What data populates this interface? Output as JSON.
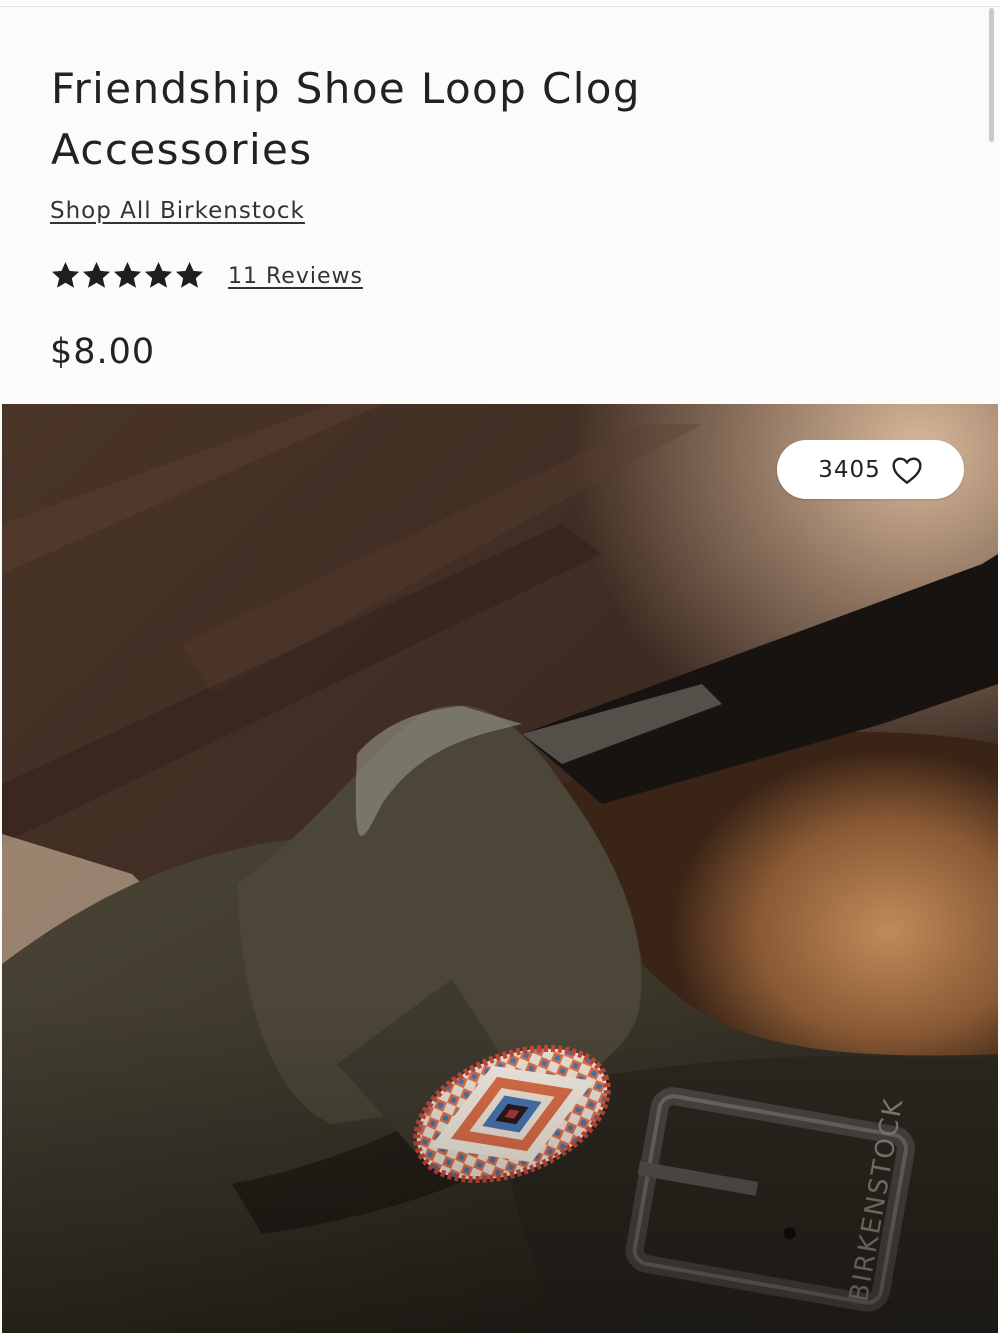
{
  "product": {
    "title": "Friendship Shoe Loop Clog Accessories",
    "brand_link": "Shop All Birkenstock",
    "rating": 5,
    "rating_max": 5,
    "reviews_link": "11 Reviews",
    "price": "$8.00"
  },
  "hero_image": {
    "subject": "suede clog strap with embroidered friendship loop",
    "stamp": "BIRKENSTOCK"
  },
  "like_button": {
    "count": "3405",
    "icon": "heart-icon"
  },
  "colors": {
    "page_background": "#fdfbfa",
    "text": "#222222",
    "suede": "#3a3529",
    "footbed": "#8a5a34"
  }
}
